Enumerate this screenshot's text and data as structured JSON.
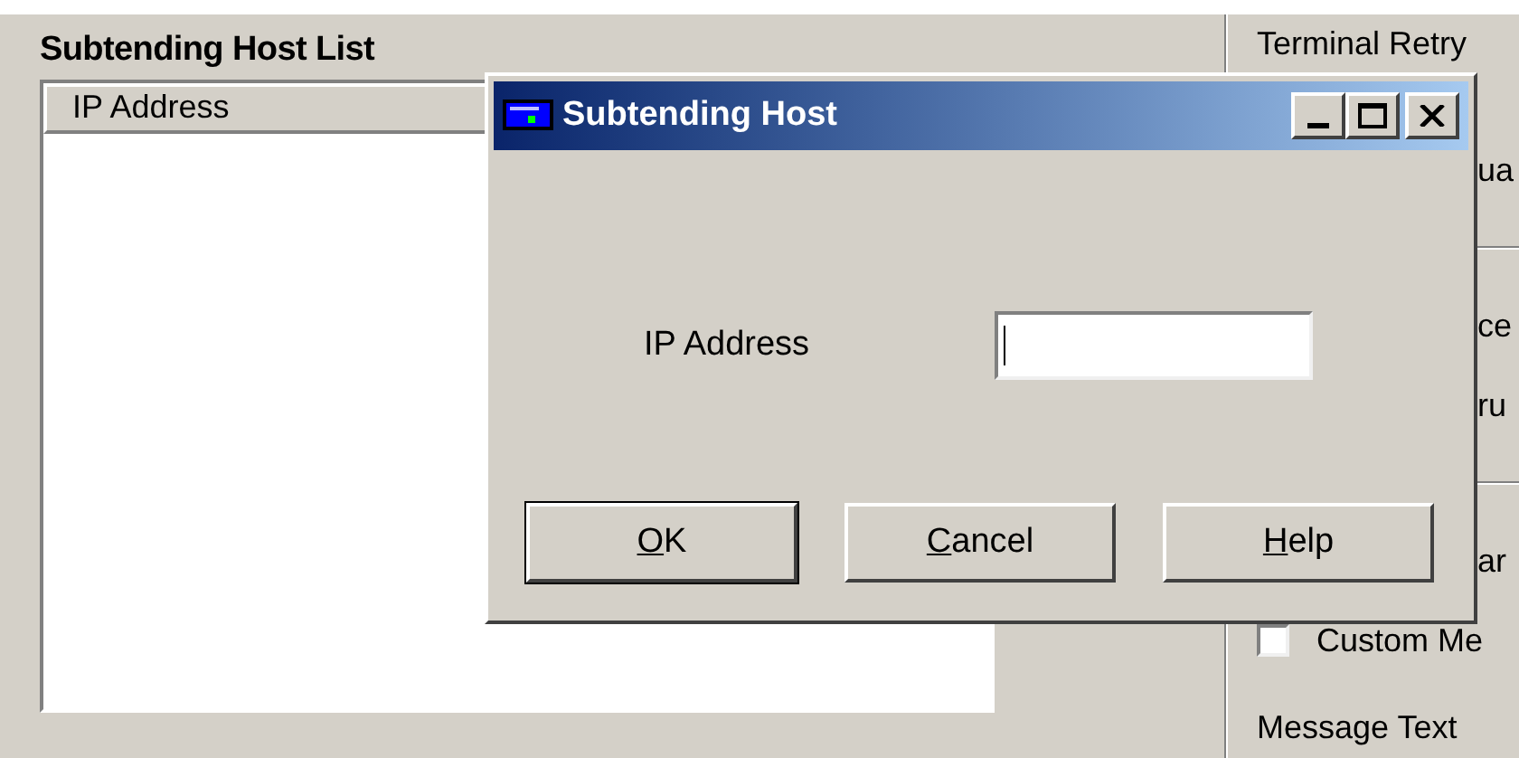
{
  "host_list": {
    "title": "Subtending Host List",
    "columns": [
      "IP Address"
    ]
  },
  "right_panel": {
    "items": [
      {
        "kind": "label",
        "text": "Terminal Retry"
      },
      {
        "kind": "clipped",
        "text": "ua"
      },
      {
        "kind": "divider"
      },
      {
        "kind": "clipped",
        "text": "ce"
      },
      {
        "kind": "clipped",
        "text": "ru"
      },
      {
        "kind": "divider"
      },
      {
        "kind": "clipped",
        "text": "ar"
      },
      {
        "kind": "checkbox",
        "text": "Custom Me",
        "checked": false
      },
      {
        "kind": "label",
        "text": "Message Text"
      }
    ]
  },
  "dialog": {
    "title": "Subtending Host",
    "field": {
      "label": "IP Address",
      "focused": true
    },
    "buttons": [
      {
        "accelerator": "O",
        "rest": "K",
        "default": true
      },
      {
        "accelerator": "C",
        "rest": "ancel",
        "default": false
      },
      {
        "accelerator": "H",
        "rest": "elp",
        "default": false
      }
    ]
  }
}
